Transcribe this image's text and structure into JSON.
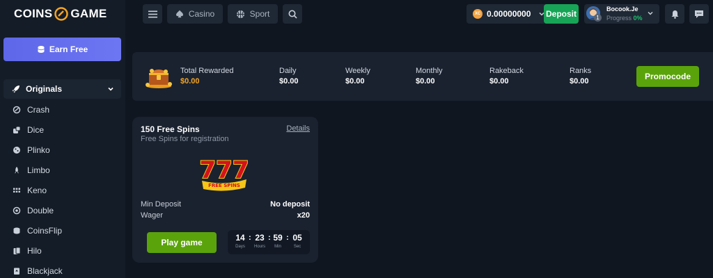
{
  "brand": {
    "part1": "COINS",
    "part2": "GAME"
  },
  "sidebar": {
    "earn_free": "Earn Free",
    "originals": "Originals",
    "items": [
      {
        "label": "Crash",
        "icon": "crash-icon"
      },
      {
        "label": "Dice",
        "icon": "dice-icon"
      },
      {
        "label": "Plinko",
        "icon": "plinko-icon"
      },
      {
        "label": "Limbo",
        "icon": "limbo-rocket-icon"
      },
      {
        "label": "Keno",
        "icon": "keno-grid-icon"
      },
      {
        "label": "Double",
        "icon": "double-icon"
      },
      {
        "label": "CoinsFlip",
        "icon": "coins-icon"
      },
      {
        "label": "Hilo",
        "icon": "cards-icon"
      },
      {
        "label": "Blackjack",
        "icon": "blackjack-icon"
      }
    ]
  },
  "topbar": {
    "casino": "Casino",
    "sport": "Sport",
    "coin_label": "XC",
    "balance": "0.00000000",
    "deposit": "Deposit",
    "username": "Bocook.Je",
    "progress_label": "Progress",
    "progress_value": "0%",
    "level": "1"
  },
  "rewards": {
    "total_label": "Total Rewarded",
    "total_value": "$0.00",
    "stats": [
      {
        "label": "Daily",
        "value": "$0.00"
      },
      {
        "label": "Weekly",
        "value": "$0.00"
      },
      {
        "label": "Monthly",
        "value": "$0.00"
      },
      {
        "label": "Rakeback",
        "value": "$0.00"
      },
      {
        "label": "Ranks",
        "value": "$0.00"
      }
    ],
    "promocode": "Promocode"
  },
  "card": {
    "title": "150 Free Spins",
    "subtitle": "Free Spins for registration",
    "details": "Details",
    "slot_digits": "777",
    "slot_banner": "FREE SPINS",
    "min_deposit_label": "Min Deposit",
    "min_deposit_value": "No deposit",
    "wager_label": "Wager",
    "wager_value": "x20",
    "play": "Play game",
    "timer": {
      "days": "14",
      "days_label": "Days",
      "hours": "23",
      "hours_label": "Hours",
      "min": "59",
      "min_label": "Min",
      "sec": "05",
      "sec_label": "Sec"
    }
  },
  "colors": {
    "background": "#0f1620",
    "panel": "#1a2230",
    "accent_green": "#5ba30b",
    "deposit_green": "#18a456",
    "earn_blue": "#5d67e8",
    "gold": "#f5a523"
  }
}
